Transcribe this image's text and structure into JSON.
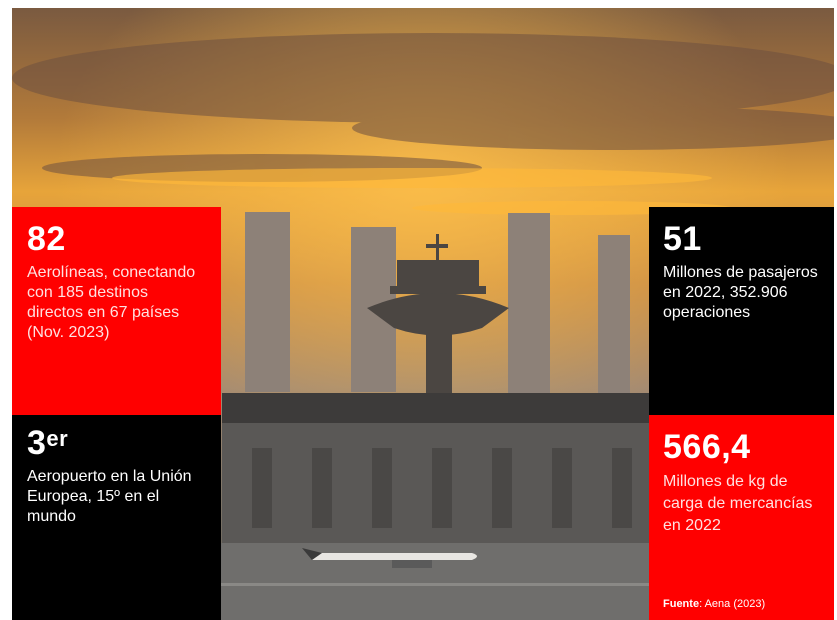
{
  "tiles": {
    "airlines": {
      "number": "82",
      "description": "Aerolíneas, conectando con 185 destinos directos en 67 países (Nov. 2023)"
    },
    "ranking": {
      "number": "3",
      "superscript": "er",
      "description": "Aeropuerto en la Unión Europea, 15º en el mundo"
    },
    "passengers": {
      "number": "51",
      "description": "Millones de pasajeros en 2022, 352.906 operaciones"
    },
    "cargo": {
      "number": "566,4",
      "description": "Millones de kg de carga de mercancías en 2022"
    }
  },
  "source": {
    "label": "Fuente",
    "text": ": Aena (2023)"
  },
  "colors": {
    "red": "#ff0000",
    "black": "#000000",
    "sky": "#d48b2a"
  }
}
